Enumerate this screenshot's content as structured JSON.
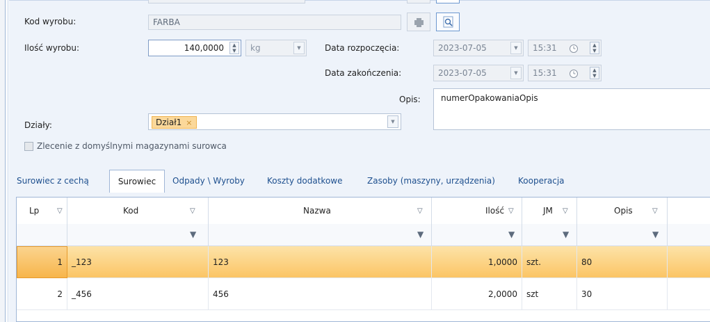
{
  "form": {
    "kod_wyrobu_label": "Kod wyrobu:",
    "kod_wyrobu_value": "FARBA",
    "ilosc_label": "Ilość wyrobu:",
    "ilosc_value": "140,0000",
    "unit_value": "kg",
    "data_rozp_label": "Data rozpoczęcia:",
    "data_rozp_date": "2023-07-05",
    "data_rozp_time": "15:31",
    "data_zak_label": "Data zakończenia:",
    "data_zak_date": "2023-07-05",
    "data_zak_time": "15:31",
    "opis_label": "Opis:",
    "opis_value": "numerOpakowaniaOpis",
    "dzialy_label": "Działy:",
    "dzialy_tag": "Dział1",
    "checkbox_label": "Zlecenie z domyślnymi magazynami surowca"
  },
  "tabs": [
    {
      "label": "Surowiec z cechą",
      "active": false
    },
    {
      "label": "Surowiec",
      "active": true
    },
    {
      "label": "Odpady \\ Wyroby",
      "active": false
    },
    {
      "label": "Koszty dodatkowe",
      "active": false
    },
    {
      "label": "Zasoby (maszyny, urządzenia)",
      "active": false
    },
    {
      "label": "Kooperacja",
      "active": false
    }
  ],
  "grid": {
    "columns": [
      "Lp",
      "Kod",
      "Nazwa",
      "Ilość",
      "JM",
      "Opis"
    ],
    "rows": [
      {
        "lp": "1",
        "kod": "_123",
        "nazwa": "123",
        "ilosc": "1,0000",
        "jm": "szt.",
        "opis": "80",
        "selected": true
      },
      {
        "lp": "2",
        "kod": "_456",
        "nazwa": "456",
        "ilosc": "2,0000",
        "jm": "szt",
        "opis": "30",
        "selected": false
      }
    ]
  },
  "colors": {
    "accent": "#1d4f8e",
    "selection": "#fbc565",
    "tag": "#fbd89a"
  }
}
